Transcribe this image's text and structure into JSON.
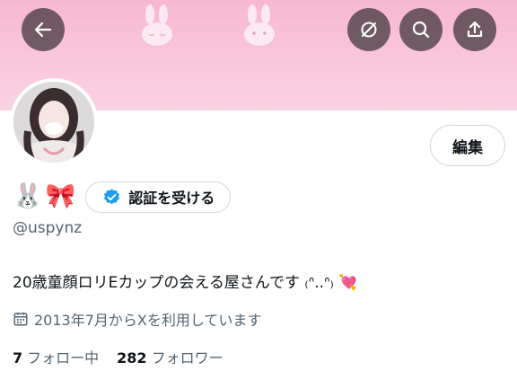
{
  "banner": {
    "back_icon": "arrow-left-icon",
    "unmute_icon": "slashed-circle-icon",
    "search_icon": "search-icon",
    "share_icon": "share-upload-icon",
    "bg_color": "#f8c3d8"
  },
  "profile": {
    "avatar_icon": "profile-photo",
    "edit_label": "編集",
    "name_emoji": [
      "🐰",
      "🎀"
    ],
    "verify_label": "認証を受ける",
    "handle": "@uspynz",
    "bio": "20歳童顔ロリEカップの会える屋さんです ₍ᐢ..ᐢ₎ 💘",
    "joined_icon": "calendar-icon",
    "joined": "2013年7月からXを利用しています",
    "following_count": "7",
    "following_label": "フォロー中",
    "followers_count": "282",
    "followers_label": "フォロワー"
  },
  "colors": {
    "accent": "#1d9bf0",
    "secondary_text": "#536471",
    "border": "#cfd9de"
  }
}
